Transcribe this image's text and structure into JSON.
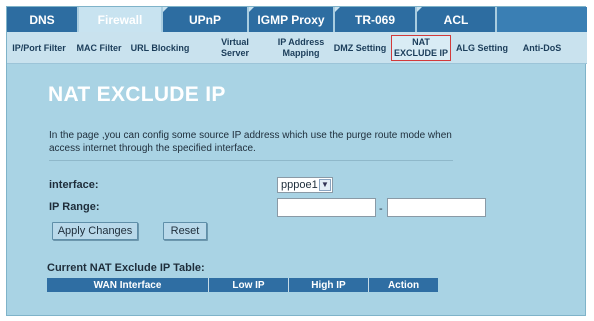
{
  "top_tabs": [
    {
      "label": "DNS"
    },
    {
      "label": "Firewall"
    },
    {
      "label": "UPnP"
    },
    {
      "label": "IGMP Proxy"
    },
    {
      "label": "TR-069"
    },
    {
      "label": "ACL"
    }
  ],
  "sub_tabs": [
    {
      "label": "IP/Port Filter"
    },
    {
      "label": "MAC Filter"
    },
    {
      "label": "URL Blocking"
    },
    {
      "label": "Virtual Server"
    },
    {
      "label": "IP Address Mapping"
    },
    {
      "label": "DMZ Setting"
    },
    {
      "label": "NAT EXCLUDE IP"
    },
    {
      "label": "ALG Setting"
    },
    {
      "label": "Anti-DoS"
    }
  ],
  "page": {
    "title": "NAT EXCLUDE IP",
    "description": "In the page ,you can config some source IP address which use the purge route mode when access internet through the specified interface."
  },
  "form": {
    "interface_label": "interface:",
    "interface_value": "pppoe1",
    "ip_range_label": "IP Range:",
    "ip_start_value": "",
    "ip_end_value": "",
    "range_separator": "-",
    "apply_label": "Apply Changes",
    "reset_label": "Reset"
  },
  "table": {
    "title": "Current NAT Exclude IP Table:",
    "columns": [
      "WAN Interface",
      "Low IP",
      "High IP",
      "Action"
    ]
  },
  "colors": {
    "background": "#a9d3e4",
    "tab_bar": "#2d6da1",
    "selected_outline": "#d23a3a"
  }
}
